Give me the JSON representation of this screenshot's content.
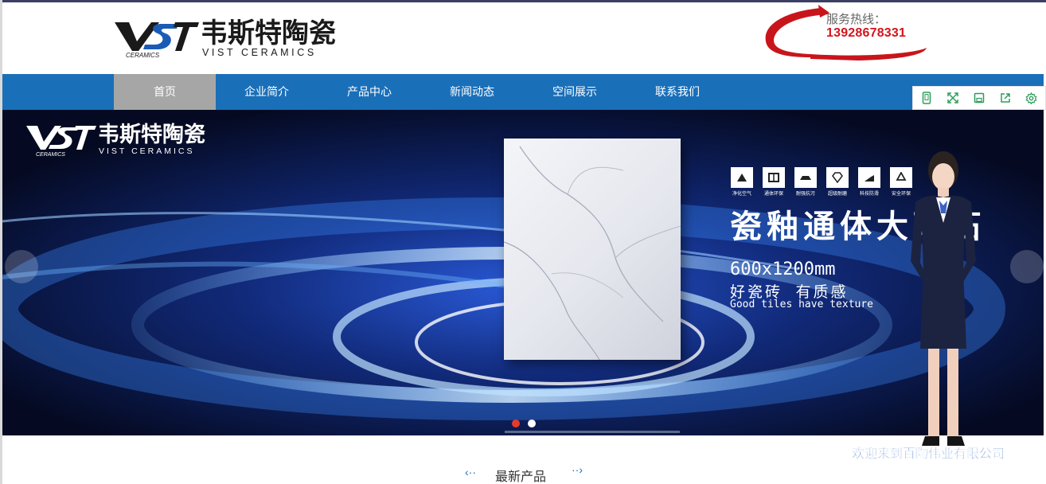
{
  "header": {
    "logo_brand_cn": "韦斯特陶瓷",
    "logo_brand_en": "VIST CERAMICS",
    "logo_mark": "VST",
    "logo_sub": "CERAMICS",
    "hotline_label": "服务热线：",
    "hotline_number": "13928678331"
  },
  "nav": {
    "items": [
      {
        "label": "首页",
        "active": true
      },
      {
        "label": "企业简介"
      },
      {
        "label": "产品中心"
      },
      {
        "label": "新闻动态"
      },
      {
        "label": "空间展示"
      },
      {
        "label": "联系我们"
      }
    ]
  },
  "toolbar": {
    "icons": [
      "mobile-icon",
      "fullscreen-icon",
      "save-icon",
      "share-icon",
      "settings-icon"
    ]
  },
  "banner": {
    "logo_brand_cn": "韦斯特陶瓷",
    "logo_brand_en": "VIST CERAMICS",
    "logo_mark": "VST",
    "logo_sub": "CERAMICS",
    "features": [
      "净化空气",
      "通体环保",
      "耐强抗污",
      "超级耐磨",
      "科技防滑",
      "安全环保"
    ],
    "title": "瓷釉通体大理石",
    "size": "600x1200mm",
    "slogan": "好瓷砖  有质感",
    "slogan_en": "Good tiles have texture",
    "slides_total": 2,
    "slide_active": 1
  },
  "assistant": {
    "welcome": "欢迎来到百陶伟业有限公司"
  },
  "section": {
    "title": "最新产品",
    "prev": "‹··",
    "next": "··›"
  },
  "colors": {
    "nav_bg": "#1a6fb9",
    "nav_active": "#a6a6a6",
    "hotline": "#d4141c",
    "dot_active": "#e53b2c"
  }
}
